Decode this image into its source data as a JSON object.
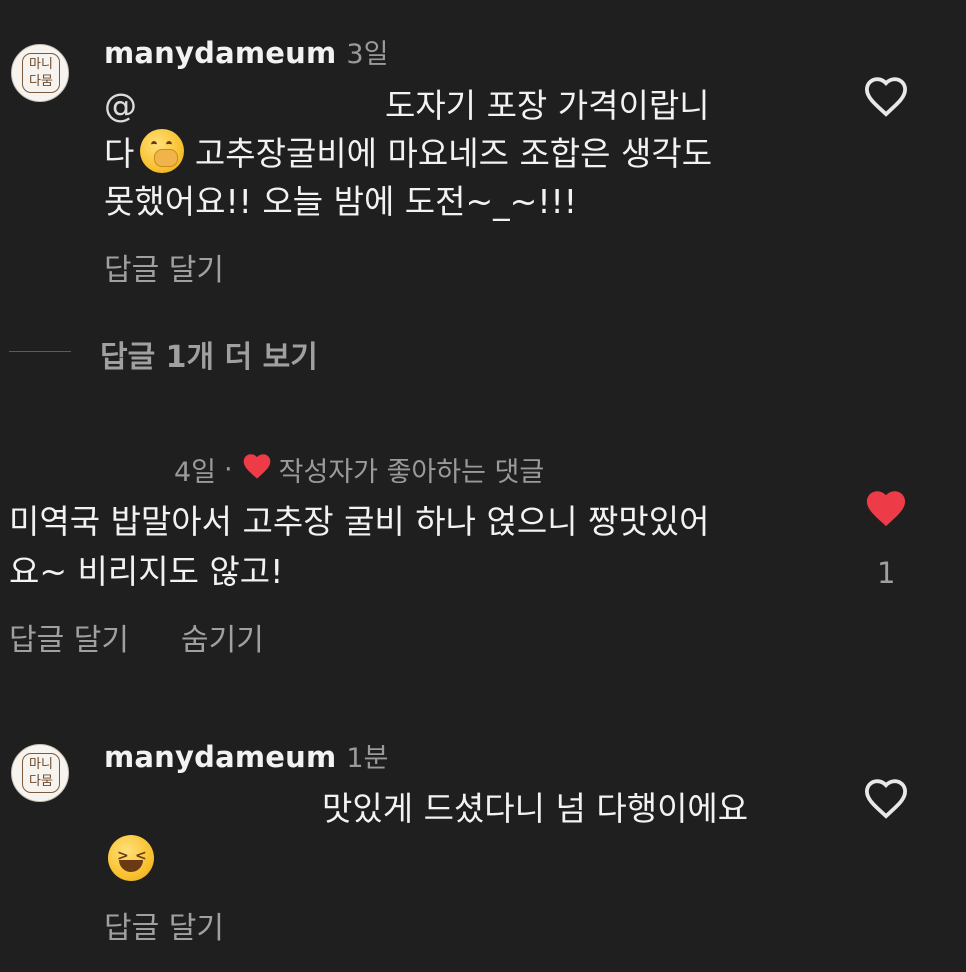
{
  "colors": {
    "background": "#1f1f1f",
    "text": "#f2f2f2",
    "muted": "#9a9a9a",
    "like_red": "#ed3b48"
  },
  "avatar_logo_text": "마니\n다뭄",
  "comment1": {
    "username": "manydameum",
    "time": "3일",
    "mention_prefix": "@",
    "line1": "도자기 포장 가격이랍니",
    "line2_a": "다",
    "line2_emoji": "face-with-hand-over-mouth-emoji",
    "line2_b": " 고추장굴비에 마요네즈 조합은 생각도",
    "line3": "못했어요!! 오늘 밤에 도전~_~!!!",
    "reply_label": "답글 달기",
    "like_icon": "heart-outline-icon"
  },
  "more_replies_label": "답글 1개 더 보기",
  "comment2": {
    "time": "4일",
    "separator": "·",
    "liked_by_author_label": "작성자가 좋아하는 댓글",
    "line1": "미역국 밥말아서 고추장 굴비 하나 얹으니 짱맛있어",
    "line2": "요~ 비리지도 않고!",
    "reply_label": "답글 달기",
    "hide_label": "숨기기",
    "like_icon": "heart-filled-icon",
    "like_count": "1"
  },
  "comment3": {
    "username": "manydameum",
    "time": "1분",
    "line1": "맛있게 드셨다니 넘 다행이에요",
    "emoji": "grinning-squinting-face-emoji",
    "reply_label": "답글 달기",
    "like_icon": "heart-outline-icon"
  }
}
